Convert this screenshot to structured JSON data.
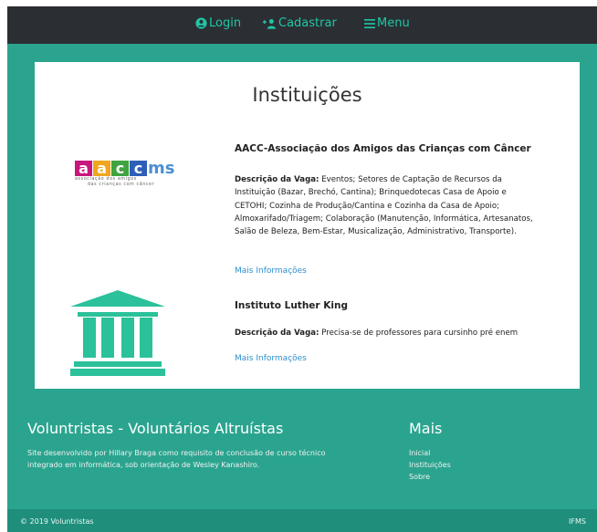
{
  "nav": {
    "login_label": "Login",
    "register_label": "Cadastrar",
    "menu_label": "Menu"
  },
  "main": {
    "title": "Instituições"
  },
  "institutions": [
    {
      "name": "AACC-Associação dos Amigos das Crianças com Câncer",
      "logo_letters": [
        "a",
        "a",
        "c",
        "c",
        "ms"
      ],
      "logo_tagline_line1": "associação dos amigos",
      "logo_tagline_line2": "das crianças com câncer",
      "desc_label": "Descrição da Vaga:",
      "desc_text": " Eventos; Setores de Captação de Recursos da Instituição (Bazar, Brechó, Cantina); Brinquedotecas Casa de Apoio e CETOHI; Cozinha de Produção/Cantina e Cozinha da Casa de Apoio; Almoxarifado/Triagem; Colaboração (Manutenção, Informática, Artesanatos, Salão de Beleza, Bem-Estar, Musicalização, Administrativo, Transporte).",
      "more_label": "Mais Informações"
    },
    {
      "name": "Instituto Luther King",
      "desc_label": "Descrição da Vaga:",
      "desc_text": " Precisa-se de professores para cursinho pré enem",
      "more_label": "Mais Informações"
    }
  ],
  "footer": {
    "title": "Voluntristas - Voluntários Altruístas",
    "text": "Site desenvolvido por Hillary Braga como requisito de conclusão de curso técnico integrado em informática, sob orientação de Wesley Kanashiro.",
    "more_title": "Mais",
    "links": [
      "Inicial",
      "Instituições",
      "Sobre"
    ],
    "copyright": "© 2019 Voluntristas",
    "right_label": "IFMS"
  },
  "colors": {
    "navbar": "#2b2f33",
    "accent": "#1fc7a6",
    "teal": "#2ba48f",
    "bottom": "#1f8f7c",
    "link": "#2b8fcf"
  },
  "icons": {
    "login": "user-circle-icon",
    "register": "user-plus-icon",
    "menu": "hamburger-icon",
    "institution": "institution-building-icon"
  }
}
